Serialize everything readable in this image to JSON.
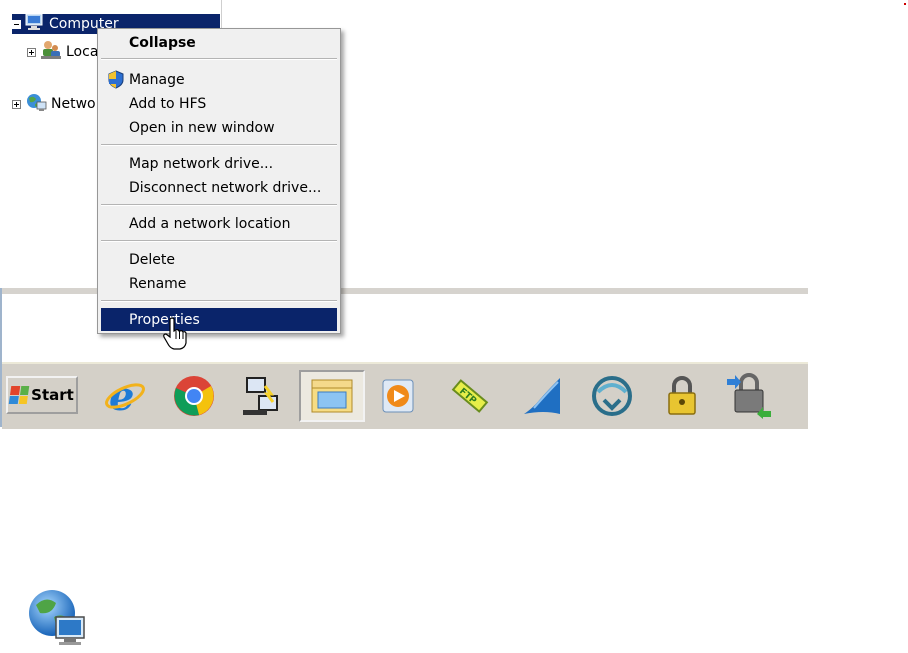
{
  "tree": {
    "items": [
      {
        "label": "Computer",
        "expander": "minus",
        "icon": "computer-icon",
        "selected": true
      },
      {
        "label": "Loca",
        "expander": "plus",
        "icon": "users-network-icon"
      },
      {
        "label": "Netwo",
        "expander": "plus",
        "icon": "network-globe-icon"
      }
    ]
  },
  "context_menu": {
    "items": [
      {
        "label": "Collapse",
        "bold": true
      },
      {
        "label": "Manage",
        "icon": "uac-shield-icon"
      },
      {
        "label": "Add to HFS"
      },
      {
        "label": "Open in new window"
      },
      {
        "label": "Map network drive..."
      },
      {
        "label": "Disconnect network drive..."
      },
      {
        "label": "Add a network location"
      },
      {
        "label": "Delete"
      },
      {
        "label": "Rename"
      },
      {
        "label": "Properties",
        "highlighted": true
      }
    ]
  },
  "taskbar": {
    "start_label": "Start",
    "icons": [
      "internet-explorer-icon",
      "chrome-icon",
      "remote-connection-icon",
      "file-explorer-icon",
      "media-player-icon",
      "ftp-icon",
      "wireshark-icon",
      "cisco-anyconnect-icon",
      "padlock-icon",
      "secure-transfer-icon"
    ]
  },
  "colors": {
    "selection": "#0a246a",
    "menu_background": "#f0f0f0",
    "taskbar": "#d4d0c8"
  }
}
